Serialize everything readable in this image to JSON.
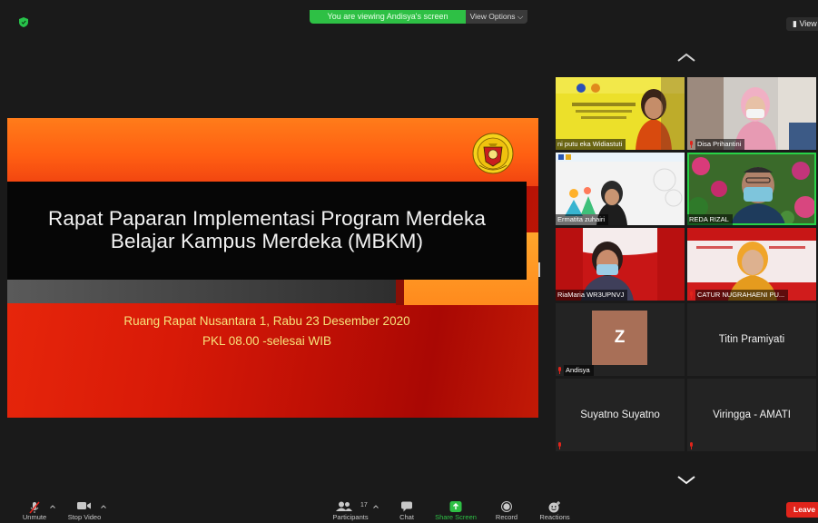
{
  "meeting": {
    "viewing_banner": "You are viewing Andisya's screen",
    "view_options": "View Options ⌵",
    "view_button": "▮ View"
  },
  "slide": {
    "title_line1": "Rapat Paparan Implementasi Program Merdeka",
    "title_line2": "Belajar Kampus Merdeka (MBKM)",
    "subtitle_line1": "Ruang Rapat Nusantara 1, Rabu 23 Desember 2020",
    "subtitle_line2": "PKL 08.00 -selesai WIB"
  },
  "gallery": {
    "participants": [
      {
        "name": "ni putu eka Widiastuti",
        "muted": false,
        "video": true
      },
      {
        "name": "Disa Prihantini",
        "muted": true,
        "video": true
      },
      {
        "name": "Ermatita zuhairi",
        "muted": false,
        "video": true
      },
      {
        "name": "REDA RIZAL",
        "muted": false,
        "video": true,
        "active_speaker": true
      },
      {
        "name": "RiaMaria WR3UPNVJ",
        "muted": false,
        "video": true
      },
      {
        "name": "CATUR NUGRAHAENI PU...",
        "muted": true,
        "video": true
      },
      {
        "name": "Andisya",
        "muted": true,
        "video": false,
        "avatar_letter": "Z"
      },
      {
        "name": "Titin Pramiyati",
        "muted": false,
        "video": false
      },
      {
        "name": "Suyatno Suyatno",
        "muted": true,
        "video": false
      },
      {
        "name": "Viringga - AMATI",
        "muted": true,
        "video": false
      }
    ]
  },
  "toolbar": {
    "unmute": "Unmute",
    "stop_video": "Stop Video",
    "participants": "Participants",
    "participants_count": "17",
    "chat": "Chat",
    "share_screen": "Share Screen",
    "record": "Record",
    "reactions": "Reactions",
    "leave": "Leave"
  },
  "colors": {
    "background": "#1a1a1a",
    "share_green": "#2ec045",
    "leave_red": "#e0241b",
    "active_outline": "#28d247"
  }
}
